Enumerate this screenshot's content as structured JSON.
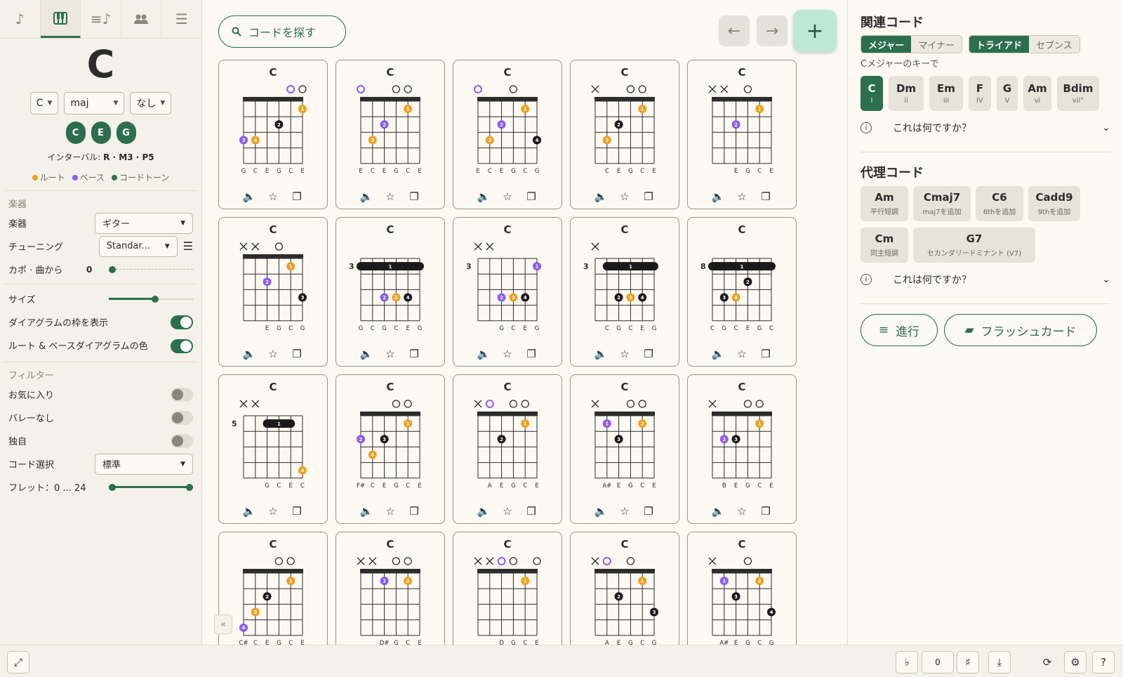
{
  "sidebar": {
    "tabs": [
      "note-icon",
      "piano-icon",
      "queue-music-icon",
      "people-icon",
      "tune-icon"
    ],
    "chord_name": "C",
    "root_select": "C",
    "quality_select": "maj",
    "ext_select": "なし",
    "notes": [
      "C",
      "E",
      "G"
    ],
    "interval_label": "インターバル:",
    "interval_value": "R · M3 · P5",
    "legend": {
      "root": "ルート",
      "bass": "ベース",
      "chordtone": "コードトーン"
    },
    "instrument_section": "楽器",
    "instrument_label": "楽器",
    "instrument_value": "ギター",
    "tuning_label": "チューニング",
    "tuning_value": "Standar...",
    "capo_label": "カポ · 曲から",
    "capo_value": "0",
    "size_label": "サイズ",
    "size_level": 0.55,
    "show_frame_label": "ダイアグラムの枠を表示",
    "root_bass_label": "ルート & ベースダイアグラムの色",
    "filter_section": "フィルター",
    "fav_label": "お気に入り",
    "nobarre_label": "バレーなし",
    "custom_label": "独自",
    "chord_select_label": "コード選択",
    "chord_select_value": "標準",
    "fret_label": "フレット：0 ... 24"
  },
  "main": {
    "search_placeholder": "コードを探す",
    "cards": [
      {
        "name": "C",
        "fret": "",
        "strings": [
          "",
          "",
          "",
          "",
          "o",
          "o"
        ],
        "rootopen": [
          4
        ],
        "dots": [
          [
            5,
            1,
            "1",
            "r"
          ],
          [
            3,
            2,
            "2",
            "k"
          ],
          [
            1,
            3,
            "4",
            "r"
          ],
          [
            0,
            3,
            "3",
            "b"
          ]
        ],
        "barre": null,
        "labels": [
          "G",
          "C",
          "E",
          "G",
          "C",
          "E"
        ]
      },
      {
        "name": "C",
        "fret": "",
        "strings": [
          "o",
          "",
          "",
          "o",
          "o",
          ""
        ],
        "rootopen": [
          0,
          5
        ],
        "dots": [
          [
            4,
            1,
            "1",
            "r"
          ],
          [
            2,
            2,
            "2",
            "b"
          ],
          [
            1,
            3,
            "3",
            "r"
          ]
        ],
        "barre": null,
        "labels": [
          "E",
          "C",
          "E",
          "G",
          "C",
          "E"
        ]
      },
      {
        "name": "C",
        "fret": "",
        "strings": [
          "o",
          "",
          "",
          "o",
          "",
          ""
        ],
        "rootopen": [
          0
        ],
        "dots": [
          [
            4,
            1,
            "1",
            "r"
          ],
          [
            2,
            2,
            "2",
            "b"
          ],
          [
            1,
            3,
            "3",
            "r"
          ],
          [
            5,
            3,
            "4",
            "k"
          ]
        ],
        "barre": null,
        "labels": [
          "E",
          "C",
          "E",
          "G",
          "C",
          "G"
        ]
      },
      {
        "name": "C",
        "fret": "",
        "strings": [
          "x",
          "",
          "",
          "o",
          "o",
          ""
        ],
        "rootopen": [],
        "dots": [
          [
            4,
            1,
            "1",
            "r"
          ],
          [
            2,
            2,
            "2",
            "k"
          ],
          [
            1,
            3,
            "3",
            "r"
          ]
        ],
        "barre": null,
        "labels": [
          "",
          "C",
          "E",
          "G",
          "C",
          "E"
        ]
      },
      {
        "name": "C",
        "fret": "",
        "strings": [
          "x",
          "x",
          "",
          "o",
          "",
          ""
        ],
        "rootopen": [
          5
        ],
        "dots": [
          [
            2,
            2,
            "2",
            "b"
          ],
          [
            4,
            1,
            "1",
            "r"
          ]
        ],
        "barre": null,
        "labels": [
          "",
          "",
          "E",
          "G",
          "C",
          "E"
        ]
      },
      {
        "name": "C",
        "fret": "",
        "strings": [
          "x",
          "x",
          "",
          "o",
          "",
          ""
        ],
        "rootopen": [],
        "dots": [
          [
            4,
            1,
            "1",
            "r"
          ],
          [
            2,
            2,
            "2",
            "b"
          ],
          [
            5,
            3,
            "3",
            "k"
          ]
        ],
        "barre": null,
        "labels": [
          "",
          "",
          "E",
          "G",
          "C",
          "G"
        ]
      },
      {
        "name": "C",
        "fret": "3",
        "strings": [
          "",
          "",
          "",
          "",
          "",
          ""
        ],
        "rootopen": [],
        "dots": [
          [
            2,
            3,
            "2",
            "b"
          ],
          [
            3,
            3,
            "3",
            "r"
          ],
          [
            4,
            3,
            "4",
            "k"
          ]
        ],
        "barre": [
          0,
          5,
          1
        ],
        "labels": [
          "G",
          "C",
          "G",
          "C",
          "E",
          "G"
        ]
      },
      {
        "name": "C",
        "fret": "3",
        "strings": [
          "x",
          "x",
          "",
          "",
          "",
          ""
        ],
        "rootopen": [],
        "dots": [
          [
            5,
            1,
            "1",
            "b"
          ],
          [
            2,
            3,
            "2",
            "b"
          ],
          [
            3,
            3,
            "3",
            "r"
          ],
          [
            4,
            3,
            "4",
            "k"
          ]
        ],
        "barre": null,
        "labels": [
          "",
          "",
          "G",
          "C",
          "E",
          "G"
        ]
      },
      {
        "name": "C",
        "fret": "3",
        "strings": [
          "x",
          "",
          "",
          "",
          "",
          ""
        ],
        "rootopen": [],
        "dots": [
          [
            2,
            3,
            "2",
            "k"
          ],
          [
            3,
            3,
            "3",
            "r"
          ],
          [
            4,
            3,
            "4",
            "k"
          ]
        ],
        "barre": [
          1,
          5,
          1
        ],
        "labels": [
          "",
          "C",
          "G",
          "C",
          "E",
          "G"
        ]
      },
      {
        "name": "C",
        "fret": "8",
        "strings": [
          "",
          "",
          "",
          "",
          "",
          ""
        ],
        "rootopen": [],
        "dots": [
          [
            3,
            2,
            "2",
            "k"
          ],
          [
            1,
            3,
            "3",
            "k"
          ],
          [
            2,
            3,
            "4",
            "r"
          ]
        ],
        "barre": [
          0,
          5,
          1
        ],
        "labels": [
          "C",
          "G",
          "C",
          "E",
          "G",
          "C"
        ]
      },
      {
        "name": "C",
        "fret": "5",
        "strings": [
          "x",
          "x",
          "",
          "",
          "",
          ""
        ],
        "rootopen": [],
        "dots": [
          [
            5,
            4,
            "4",
            "r"
          ]
        ],
        "barre": [
          2,
          4,
          1
        ],
        "labels": [
          "",
          "",
          "G",
          "C",
          "E",
          "C"
        ]
      },
      {
        "name": "C",
        "fret": "",
        "strings": [
          "",
          "",
          "",
          "o",
          "o",
          ""
        ],
        "rootopen": [],
        "dots": [
          [
            4,
            1,
            "1",
            "r"
          ],
          [
            2,
            2,
            "3",
            "k"
          ],
          [
            0,
            2,
            "2",
            "b"
          ],
          [
            1,
            3,
            "4",
            "r"
          ]
        ],
        "barre": null,
        "labels": [
          "F#",
          "C",
          "E",
          "G",
          "C",
          "E"
        ]
      },
      {
        "name": "C",
        "fret": "",
        "strings": [
          "x",
          "o",
          "",
          "o",
          "o",
          ""
        ],
        "rootopen": [
          1
        ],
        "dots": [
          [
            4,
            1,
            "1",
            "r"
          ],
          [
            2,
            2,
            "2",
            "k"
          ]
        ],
        "barre": null,
        "labels": [
          "",
          "A",
          "E",
          "G",
          "C",
          "E"
        ]
      },
      {
        "name": "C",
        "fret": "",
        "strings": [
          "x",
          "",
          "",
          "o",
          "o",
          ""
        ],
        "rootopen": [],
        "dots": [
          [
            1,
            1,
            "1",
            "b"
          ],
          [
            4,
            1,
            "2",
            "r"
          ],
          [
            2,
            2,
            "3",
            "k"
          ]
        ],
        "barre": null,
        "labels": [
          "",
          "A#",
          "E",
          "G",
          "C",
          "E"
        ]
      },
      {
        "name": "C",
        "fret": "",
        "strings": [
          "x",
          "",
          "",
          "o",
          "o",
          ""
        ],
        "rootopen": [],
        "dots": [
          [
            1,
            2,
            "2",
            "b"
          ],
          [
            2,
            2,
            "3",
            "k"
          ],
          [
            4,
            1,
            "1",
            "r"
          ]
        ],
        "barre": null,
        "labels": [
          "",
          "B",
          "E",
          "G",
          "C",
          "E"
        ]
      },
      {
        "name": "C",
        "fret": "",
        "strings": [
          "",
          "",
          "",
          "o",
          "o",
          ""
        ],
        "rootopen": [],
        "dots": [
          [
            4,
            1,
            "1",
            "r"
          ],
          [
            2,
            2,
            "2",
            "k"
          ],
          [
            1,
            3,
            "3",
            "r"
          ],
          [
            0,
            4,
            "4",
            "b"
          ]
        ],
        "barre": null,
        "labels": [
          "C#",
          "C",
          "E",
          "G",
          "C",
          "E"
        ]
      },
      {
        "name": "C",
        "fret": "",
        "strings": [
          "x",
          "x",
          "",
          "o",
          "o",
          ""
        ],
        "rootopen": [],
        "dots": [
          [
            2,
            1,
            "1",
            "b"
          ],
          [
            4,
            1,
            "2",
            "r"
          ]
        ],
        "barre": null,
        "labels": [
          "",
          "",
          "D#",
          "G",
          "C",
          "E"
        ]
      },
      {
        "name": "C",
        "fret": "",
        "strings": [
          "x",
          "x",
          "o",
          "o",
          "",
          "o"
        ],
        "rootopen": [
          2
        ],
        "dots": [
          [
            4,
            1,
            "1",
            "r"
          ]
        ],
        "barre": null,
        "labels": [
          "",
          "",
          "D",
          "G",
          "C",
          "E"
        ]
      },
      {
        "name": "C",
        "fret": "",
        "strings": [
          "x",
          "o",
          "",
          "o",
          "",
          ""
        ],
        "rootopen": [
          1
        ],
        "dots": [
          [
            4,
            1,
            "1",
            "r"
          ],
          [
            2,
            2,
            "2",
            "k"
          ],
          [
            5,
            3,
            "3",
            "k"
          ]
        ],
        "barre": null,
        "labels": [
          "",
          "A",
          "E",
          "G",
          "C",
          "G"
        ]
      },
      {
        "name": "C",
        "fret": "",
        "strings": [
          "x",
          "",
          "",
          "o",
          "",
          ""
        ],
        "rootopen": [],
        "dots": [
          [
            1,
            1,
            "1",
            "b"
          ],
          [
            4,
            1,
            "2",
            "r"
          ],
          [
            2,
            2,
            "3",
            "k"
          ],
          [
            5,
            3,
            "4",
            "k"
          ]
        ],
        "barre": null,
        "labels": [
          "",
          "A#",
          "E",
          "G",
          "C",
          "G"
        ]
      }
    ]
  },
  "right": {
    "related_title": "関連コード",
    "seg1": [
      "メジャー",
      "マイナー"
    ],
    "seg2": [
      "トライアド",
      "セブンス"
    ],
    "key_caption": "Cメジャーのキーで",
    "keys": [
      {
        "m": "C",
        "s": "I"
      },
      {
        "m": "Dm",
        "s": "ii"
      },
      {
        "m": "Em",
        "s": "iii"
      },
      {
        "m": "F",
        "s": "IV"
      },
      {
        "m": "G",
        "s": "V"
      },
      {
        "m": "Am",
        "s": "vi"
      },
      {
        "m": "Bdim",
        "s": "vii°"
      }
    ],
    "what_is_this": "これは何ですか？",
    "subst_title": "代理コード",
    "subst": [
      {
        "m": "Am",
        "s": "平行短調"
      },
      {
        "m": "Cmaj7",
        "s": "maj7を追加"
      },
      {
        "m": "C6",
        "s": "6thを追加"
      },
      {
        "m": "Cadd9",
        "s": "9thを追加"
      },
      {
        "m": "Cm",
        "s": "同主短調"
      },
      {
        "m": "G7",
        "s": "セカンダリードミナント (V7)"
      }
    ],
    "progression_label": "進行",
    "flashcard_label": "フラッシュカード"
  },
  "bottombar": {
    "flat": "♭",
    "transpose": "0",
    "sharp": "♯"
  },
  "colors": {
    "accent": "#2c6e4e",
    "root": "#f0a020",
    "bass": "#8b5cf6",
    "tone": "#1a1a1a"
  }
}
